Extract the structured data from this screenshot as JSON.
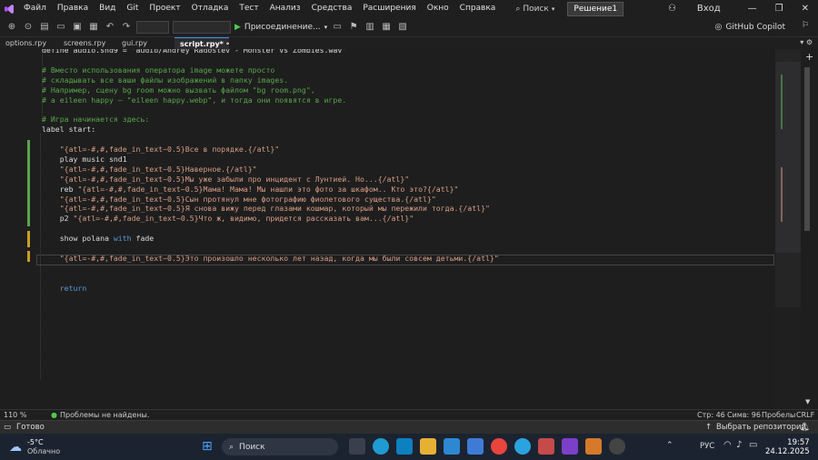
{
  "menubar": {
    "items": [
      "Файл",
      "Правка",
      "Вид",
      "Git",
      "Проект",
      "Отладка",
      "Тест",
      "Анализ",
      "Средства",
      "Расширения",
      "Окно",
      "Справка"
    ],
    "search_label": "Поиск",
    "solution_badge": "Решение1",
    "signin_label": "Вход"
  },
  "toolbar": {
    "attach_label": "Присоединение...",
    "copilot_label": "GitHub Copilot"
  },
  "tabs": [
    {
      "label": "options.rpy"
    },
    {
      "label": "screens.rpy"
    },
    {
      "label": "gui.rpy"
    },
    {
      "label": "script.rpy*"
    }
  ],
  "editor": {
    "lines": [
      {
        "text": "define audio.snd9 = \"audio/Andrey Radostev - Monster vs Zombies.wav\"",
        "cls": "c-plain"
      },
      {
        "text": "",
        "cls": "c-plain"
      },
      {
        "text": "# Вместо использования оператора image можете просто",
        "cls": "c-comment"
      },
      {
        "text": "# складывать все ваши файлы изображений в папку images.",
        "cls": "c-comment"
      },
      {
        "text": "# Например, сцену bg room можно вызвать файлом \"bg room.png\",",
        "cls": "c-comment"
      },
      {
        "text": "# а eileen happy — \"eileen happy.webp\", и тогда они появятся в игре.",
        "cls": "c-comment"
      },
      {
        "text": "",
        "cls": "c-plain"
      },
      {
        "text": "# Игра начинается здесь:",
        "cls": "c-comment"
      },
      {
        "text": "label start:",
        "cls": "c-plain"
      },
      {
        "text": "",
        "cls": "c-plain"
      },
      {
        "text": "    \"{atl=-#,#,fade_in_text~0.5}Все в порядке.{/atl}\"",
        "cls": "c-str"
      },
      {
        "text": "    play music snd1",
        "cls": "c-plain"
      },
      {
        "text": "    \"{atl=-#,#,fade_in_text~0.5}Наверное.{/atl}\"",
        "cls": "c-str"
      },
      {
        "text": "    \"{atl=-#,#,fade_in_text~0.5}Мы уже забыли про инцидент с Лунтией. Но...{/atl}\"",
        "cls": "c-str"
      },
      {
        "text": "    reb \"{atl=-#,#,fade_in_text~0.5}Мама! Мама! Мы нашли это фото за шкафом.. Кто это?{/atl}\"",
        "cls": "mixed",
        "prefix": "    reb "
      },
      {
        "text": "    \"{atl=-#,#,fade_in_text~0.5}Сын протянул мне фотографию фиолетового существа.{/atl}\"",
        "cls": "c-str"
      },
      {
        "text": "    \"{atl=-#,#,fade_in_text~0.5}Я снова вижу перед глазами кошмар, который мы пережили тогда.{/atl}\"",
        "cls": "c-str"
      },
      {
        "text": "    p2 \"{atl=-#,#,fade_in_text~0.5}Что ж, видимо, придется рассказать вам...{/atl}\"",
        "cls": "mixed",
        "prefix": "    p2 "
      },
      {
        "text": "",
        "cls": "c-plain"
      },
      {
        "text": "    show polana with fade",
        "cls": "show"
      },
      {
        "text": "",
        "cls": "c-plain"
      },
      {
        "text": "    \"{atl=-#,#,fade_in_text~0.5}Это произошло несколько лет назад, когда мы были совсем детьми.{/atl}\"",
        "cls": "c-str"
      },
      {
        "text": "",
        "cls": "c-plain"
      },
      {
        "text": "",
        "cls": "c-plain"
      },
      {
        "text": "    return",
        "cls": "c-kw"
      }
    ]
  },
  "statusline": {
    "zoom": "110 %",
    "problems": "Проблемы не найдены.",
    "line": "Стр: 46",
    "char": "Симв: 96",
    "spaces": "Пробелы",
    "eol": "CRLF"
  },
  "statusbar": {
    "ready": "Готово",
    "repo": "Выбрать репозиторий"
  },
  "taskbar": {
    "temp": "-5°C",
    "weather": "Облачно",
    "search": "Поиск",
    "lang": "РУС",
    "time": "19:57",
    "date": "24.12.2025"
  },
  "colors": {
    "accent": "#3794ff",
    "comment": "#57a64a",
    "string": "#d69d85",
    "keyword": "#569cd6",
    "taskbar": "#1c2330"
  }
}
